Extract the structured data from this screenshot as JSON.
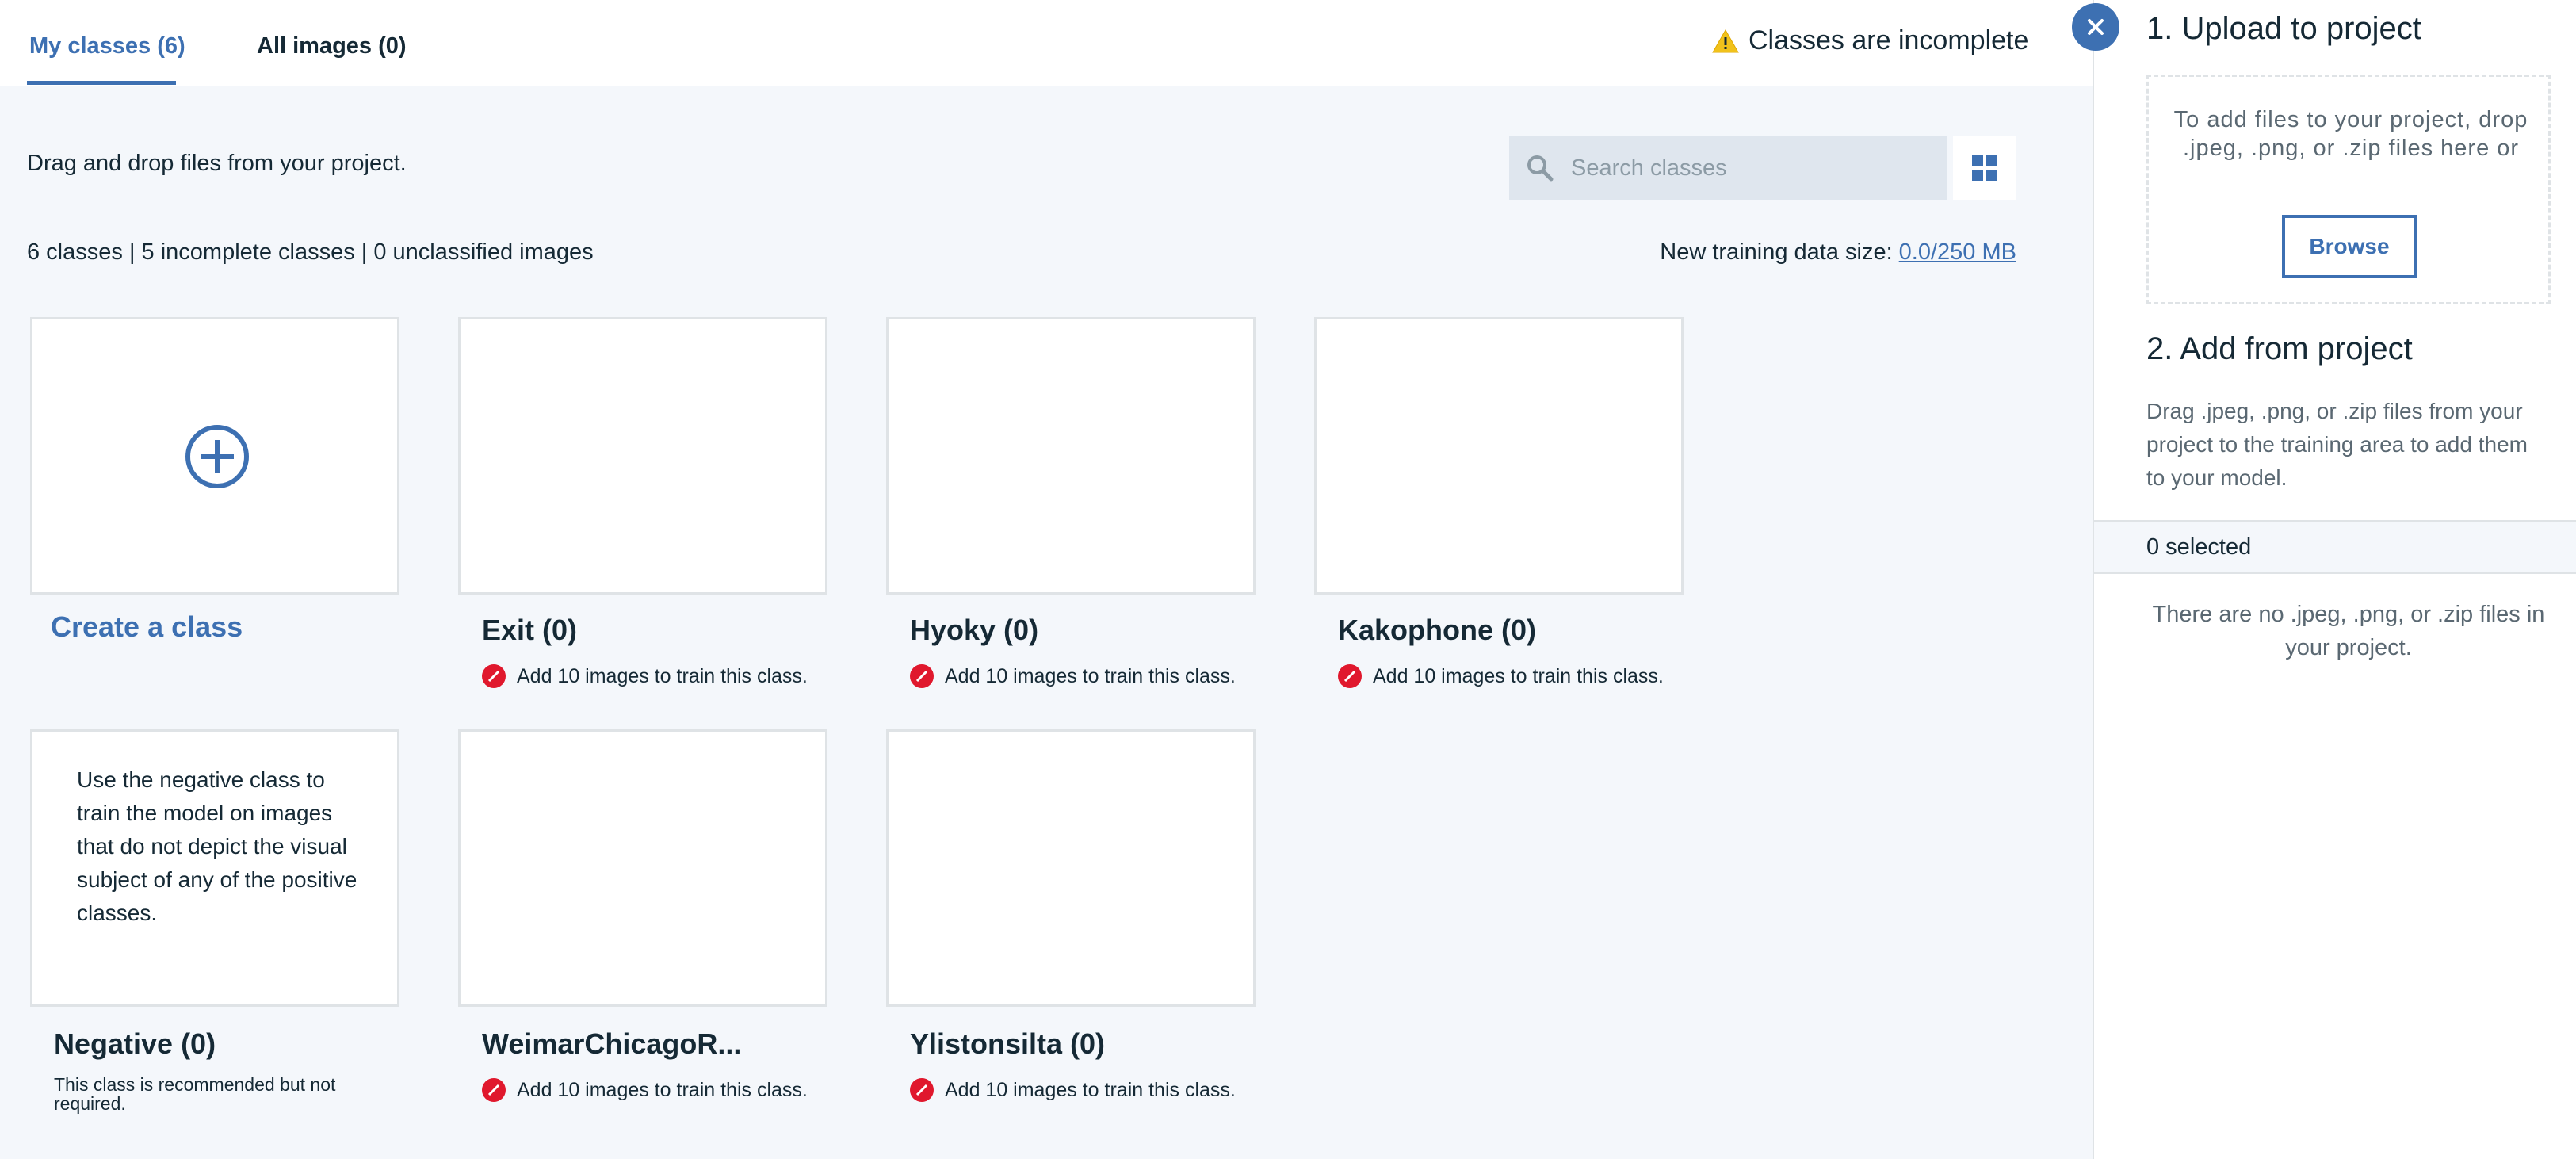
{
  "tabs": {
    "my_classes": "My classes (6)",
    "all_images": "All images (0)"
  },
  "status": {
    "warning_text": "Classes are incomplete",
    "warning_color": "#f1c21b"
  },
  "toolbar": {
    "drag_hint": "Drag and drop files from your project.",
    "search_placeholder": "Search classes"
  },
  "summary": {
    "stats": "6 classes | 5 incomplete classes | 0 unclassified images",
    "size_label": "New training data size:",
    "size_value": "0.0/250 MB"
  },
  "create_card": {
    "label": "Create a class"
  },
  "classes": [
    {
      "title": "Exit (0)",
      "note": "Add 10 images to train this class."
    },
    {
      "title": "Hyoky (0)",
      "note": "Add 10 images to train this class."
    },
    {
      "title": "Kakophone (0)",
      "note": "Add 10 images to train this class."
    },
    {
      "title": "WeimarChicagoR...",
      "note": "Add 10 images to train this class."
    },
    {
      "title": "Ylistonsilta (0)",
      "note": "Add 10 images to train this class."
    }
  ],
  "negative_card": {
    "description": "Use the negative class to train the model on images that do not depict the visual subject of any of the positive classes.",
    "title": "Negative (0)",
    "note": "This class is recommended but not required."
  },
  "panel": {
    "upload_heading": "1. Upload to project",
    "dropzone_text": "To add files to your project, drop .jpeg, .png, or .zip files here or",
    "browse_label": "Browse",
    "add_heading": "2. Add from project",
    "add_text": "Drag .jpeg, .png, or .zip files from your project to the training area to add them to your model.",
    "selected_text": "0 selected",
    "empty_text": "There are no .jpeg, .png, or .zip files in your project."
  },
  "colors": {
    "accent": "#3d70b2",
    "error": "#e0182d",
    "background": "#f4f7fb"
  }
}
